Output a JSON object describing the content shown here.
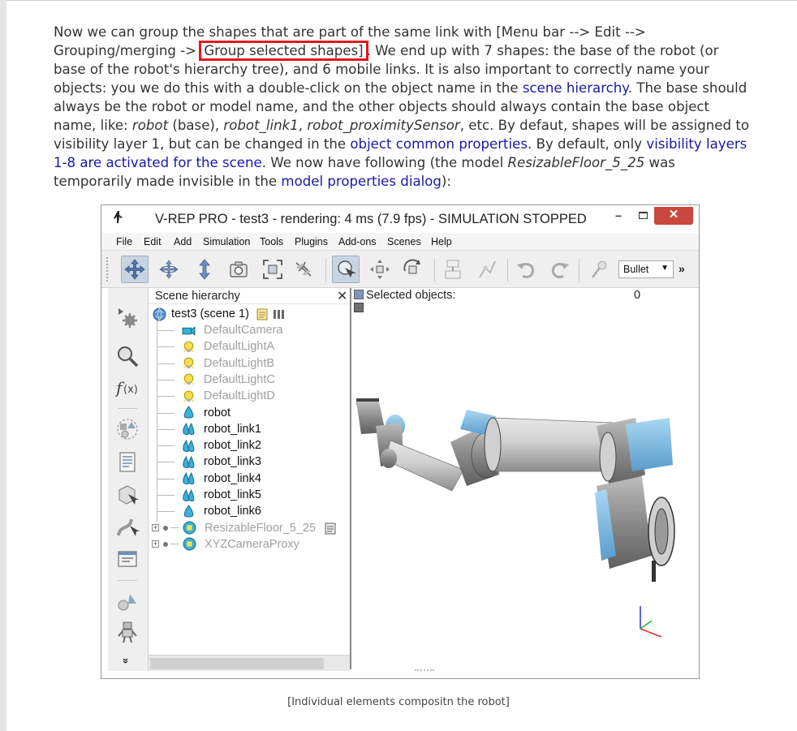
{
  "doc": {
    "p_1": "Now we can group the shapes that are part of the same link with [Menu bar --> Edit --> Grouping/merging -> ",
    "p_highlight": "Group selected shapes]",
    "p_2": ". We end up with 7 shapes: the base of the robot (or base of the robot's hierarchy tree), and 6 mobile links. It is also important to correctly name your objects: you we do this with a double-click on the object name in the ",
    "link_scene_hierarchy": "scene hierarchy",
    "p_3": ". The base should always be the robot or model name, and the other objects should always contain the base object name, like: ",
    "ex_robot": "robot",
    "p_4": " (base), ",
    "ex_link1": "robot_link1",
    "p_5": ", ",
    "ex_prox": "robot_proximitySensor",
    "p_6": ", etc. By defaut, shapes will be assigned to visibility layer 1, but can be changed in the ",
    "link_common_props": "object common properties",
    "p_7": ". By default, only ",
    "link_visibility": "visibility layers 1-8 are activated for the scene",
    "p_8": ". We now have following (the model ",
    "ex_floor": "ResizableFloor_5_25",
    "p_9": " was temporarily made invisible in the ",
    "link_model_props": "model properties dialog",
    "p_10": "):",
    "caption": "[Individual elements compositn the robot]"
  },
  "window": {
    "title": "V-REP PRO - test3 - rendering: 4 ms (7.9 fps) - SIMULATION STOPPED",
    "min": "–",
    "close": "✕",
    "menu": [
      "File",
      "Edit",
      "Add",
      "Simulation",
      "Tools",
      "Plugins",
      "Add-ons",
      "Scenes",
      "Help"
    ],
    "engine": "Bullet",
    "engine_arrow": "▼",
    "more": "»",
    "left_more": "»"
  },
  "hierarchy": {
    "title": "Scene hierarchy",
    "close": "✕",
    "scene": "test3 (scene 1)",
    "items": [
      {
        "label": "DefaultCamera",
        "icon": "camera-icon",
        "color": "#a0a0a0"
      },
      {
        "label": "DefaultLightA",
        "icon": "light-icon",
        "color": "#a0a0a0"
      },
      {
        "label": "DefaultLightB",
        "icon": "light-icon",
        "color": "#a0a0a0"
      },
      {
        "label": "DefaultLightC",
        "icon": "light-icon",
        "color": "#a0a0a0"
      },
      {
        "label": "DefaultLightD",
        "icon": "light-icon",
        "color": "#a0a0a0"
      },
      {
        "label": "robot",
        "icon": "shape-icon",
        "color": "#111111"
      },
      {
        "label": "robot_link1",
        "icon": "compound-shape-icon",
        "color": "#111111"
      },
      {
        "label": "robot_link2",
        "icon": "compound-shape-icon",
        "color": "#111111"
      },
      {
        "label": "robot_link3",
        "icon": "compound-shape-icon",
        "color": "#111111"
      },
      {
        "label": "robot_link4",
        "icon": "compound-shape-icon",
        "color": "#111111"
      },
      {
        "label": "robot_link5",
        "icon": "compound-shape-icon",
        "color": "#111111"
      },
      {
        "label": "robot_link6",
        "icon": "shape-icon",
        "color": "#111111"
      },
      {
        "label": "ResizableFloor_5_25",
        "icon": "model-icon",
        "color": "#a0a0a0"
      },
      {
        "label": "XYZCameraProxy",
        "icon": "model-icon",
        "color": "#a0a0a0"
      }
    ]
  },
  "view": {
    "selected_label": "Selected objects:",
    "selected_count": "0"
  },
  "colors": {
    "link": "#1a1aa8",
    "highlight_border": "#e0191f",
    "robot_gray": "#8a8a8a",
    "robot_blue": "#6fb3df",
    "close_btn": "#c9473c"
  }
}
